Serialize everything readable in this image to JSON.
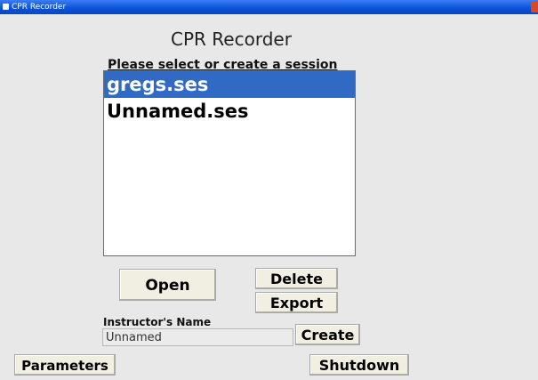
{
  "window": {
    "title": "CPR Recorder"
  },
  "header": {
    "app_title": "CPR Recorder",
    "prompt": "Please select or create a session"
  },
  "sessions": {
    "items": [
      {
        "name": "gregs.ses",
        "selected": true
      },
      {
        "name": "Unnamed.ses",
        "selected": false
      }
    ]
  },
  "buttons": {
    "open": "Open",
    "delete": "Delete",
    "export": "Export",
    "create": "Create",
    "parameters": "Parameters",
    "shutdown": "Shutdown"
  },
  "instructor": {
    "label": "Instructor's Name",
    "value": "Unnamed"
  },
  "colors": {
    "titlebar": "#0a52d8",
    "selection": "#316ac5",
    "button_face": "#f1efe2",
    "background": "#e8e8e8"
  }
}
